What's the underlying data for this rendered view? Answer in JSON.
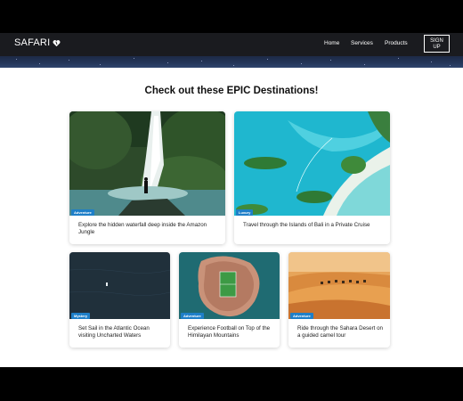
{
  "nav": {
    "brand": "SAFARI",
    "links": [
      "Home",
      "Services",
      "Products"
    ],
    "signup_line1": "SIGN",
    "signup_line2": "UP"
  },
  "heading": "Check out these EPIC Destinations!",
  "cards": [
    {
      "badge": "Adventure",
      "caption": "Explore the hidden waterfall deep inside the Amazon Jungle",
      "image": "waterfall-jungle"
    },
    {
      "badge": "Luxury",
      "caption": "Travel through the Islands of Bali in a Private Cruise",
      "image": "bali-islands-aerial"
    },
    {
      "badge": "Mystery",
      "caption": "Set Sail in the Atlantic Ocean visiting Uncharted Waters",
      "image": "dark-ocean-boat"
    },
    {
      "badge": "Adventure",
      "caption": "Experience Football on Top of the Himilayan Mountains",
      "image": "island-football-field"
    },
    {
      "badge": "Adventure",
      "caption": "Ride through the Sahara Desert on a guided camel tour",
      "image": "desert-camels"
    }
  ],
  "colors": {
    "navbar": "#1a1b1f",
    "badge": "#1e7fc8",
    "page_bg": "#ffffff"
  }
}
